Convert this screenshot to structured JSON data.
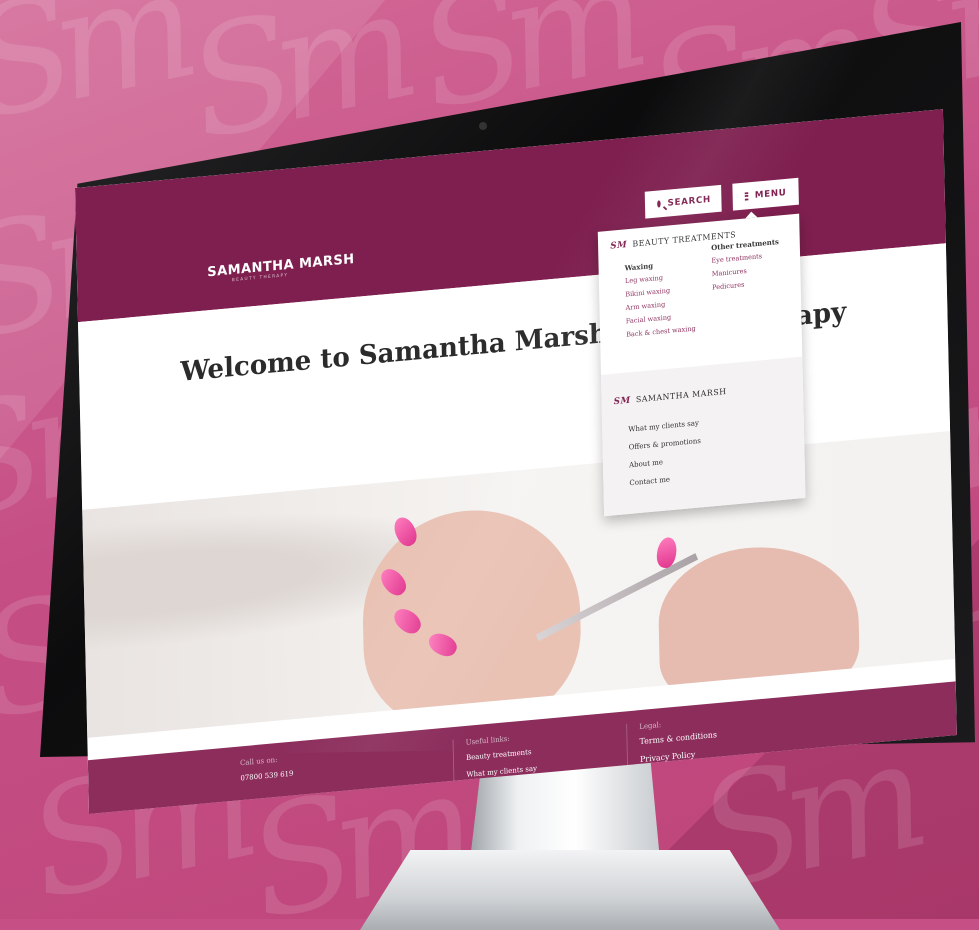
{
  "site": {
    "logo": "SAMANTHA MARSH",
    "logo_sub": "BEAUTY THERAPY"
  },
  "header": {
    "search_label": "SEARCH",
    "menu_label": "MENU"
  },
  "hero": {
    "title": "Welcome to Samantha Marsh Beauty Therapy"
  },
  "dropdown": {
    "logo_mark": "SM",
    "treatments_heading": "BEAUTY TREATMENTS",
    "waxing_title": "Waxing",
    "waxing_items": [
      "Leg waxing",
      "Bikini waxing",
      "Arm waxing",
      "Facial waxing",
      "Back & chest waxing"
    ],
    "other_title": "Other treatments",
    "other_items": [
      "Eye treatments",
      "Manicures",
      "Pedicures"
    ],
    "brand_heading": "SAMANTHA MARSH",
    "brand_items": [
      "What my clients say",
      "Offers & promotions",
      "About me",
      "Contact me"
    ]
  },
  "footer": {
    "call_label": "Call us on:",
    "phone": "07800 539 619",
    "useful_label": "Useful links:",
    "useful_links": [
      "Beauty treatments",
      "What my clients say"
    ],
    "legal_label": "Legal:",
    "legal_links": [
      "Terms & conditions",
      "Privacy Policy"
    ]
  },
  "colors": {
    "brand": "#7e1f4f",
    "background": "#c64f86",
    "nail_polish": "#e0338d"
  },
  "icons": [
    "search-icon",
    "menu-icon"
  ]
}
